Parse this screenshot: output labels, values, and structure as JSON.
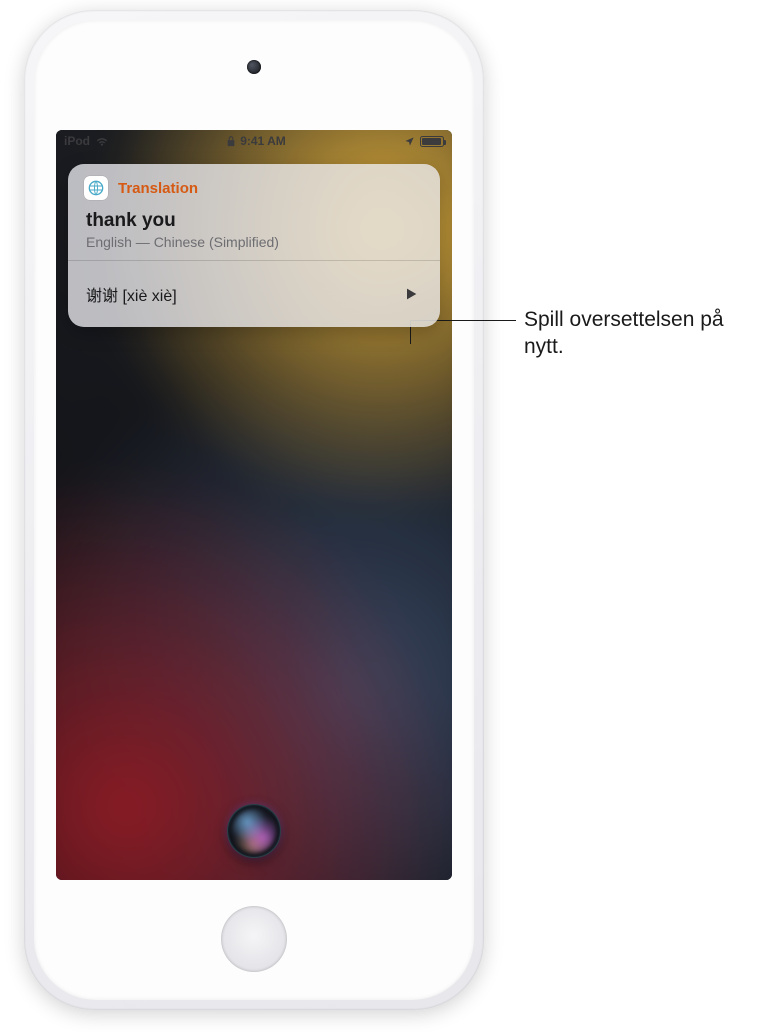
{
  "status_bar": {
    "carrier": "iPod",
    "time": "9:41 AM"
  },
  "card": {
    "app_name": "Translation",
    "source_phrase": "thank you",
    "language_pair": "English — Chinese (Simplified)",
    "translated_line": "谢谢 [xiè xiè]"
  },
  "callout": {
    "text": "Spill oversettelsen på nytt."
  }
}
